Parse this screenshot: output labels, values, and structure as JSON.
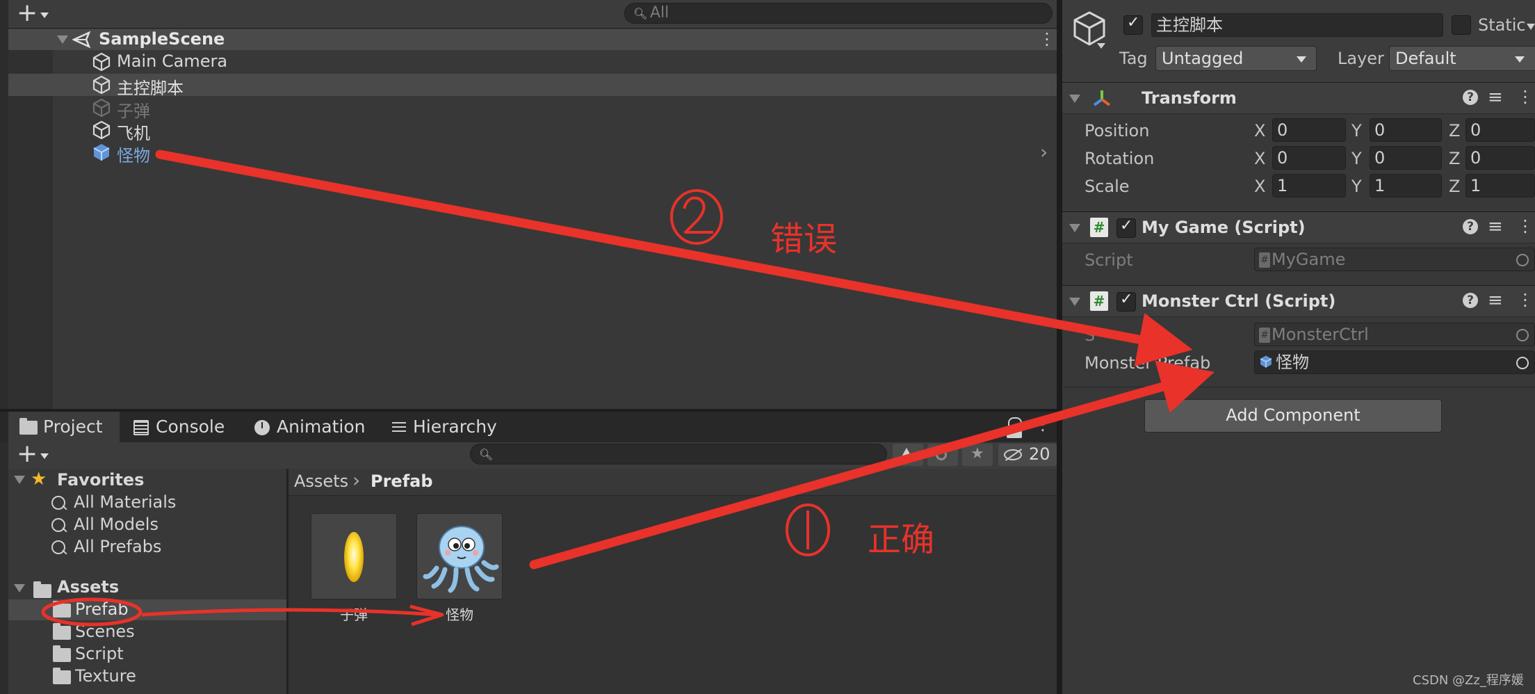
{
  "hierarchy": {
    "search_placeholder": "All",
    "scene": "SampleScene",
    "items": [
      {
        "label": "Main Camera"
      },
      {
        "label": "主控脚本"
      },
      {
        "label": "子弹"
      },
      {
        "label": "飞机"
      },
      {
        "label": "怪物"
      }
    ]
  },
  "inspector": {
    "object_name": "主控脚本",
    "static_label": "Static",
    "tag_label": "Tag",
    "tag_value": "Untagged",
    "layer_label": "Layer",
    "layer_value": "Default",
    "transform": {
      "title": "Transform",
      "rows": [
        {
          "label": "Position",
          "x": "0",
          "y": "0",
          "z": "0"
        },
        {
          "label": "Rotation",
          "x": "0",
          "y": "0",
          "z": "0"
        },
        {
          "label": "Scale",
          "x": "1",
          "y": "1",
          "z": "1"
        }
      ],
      "axis_labels": [
        "X",
        "Y",
        "Z"
      ]
    },
    "my_game": {
      "title": "My Game (Script)",
      "script_label": "Script",
      "script_value": "MyGame"
    },
    "monster_ctrl": {
      "title": "Monster Ctrl (Script)",
      "script_label": "S",
      "script_value": "MonsterCtrl",
      "prefab_label": "Monster Prefab",
      "prefab_value": "怪物"
    },
    "add_component": "Add Component"
  },
  "bottom_tabs": {
    "project": "Project",
    "console": "Console",
    "animation": "Animation",
    "hierarchy": "Hierarchy"
  },
  "project": {
    "badge_count": "20",
    "favorites_title": "Favorites",
    "favorites": [
      "All Materials",
      "All Models",
      "All Prefabs"
    ],
    "assets_title": "Assets",
    "folders": [
      "Prefab",
      "Scenes",
      "Script",
      "Texture"
    ],
    "breadcrumb": {
      "root": "Assets",
      "current": "Prefab"
    },
    "assets": [
      {
        "label": "子弹"
      },
      {
        "label": "怪物"
      }
    ]
  },
  "annotations": {
    "wrong_label": "错误",
    "correct_label": "正确",
    "watermark": "CSDN @Zz_程序媛"
  },
  "colors": {
    "accent_blue": "#7ba7e0",
    "annotation_red": "#e8322a",
    "panel_bg": "#383838"
  }
}
